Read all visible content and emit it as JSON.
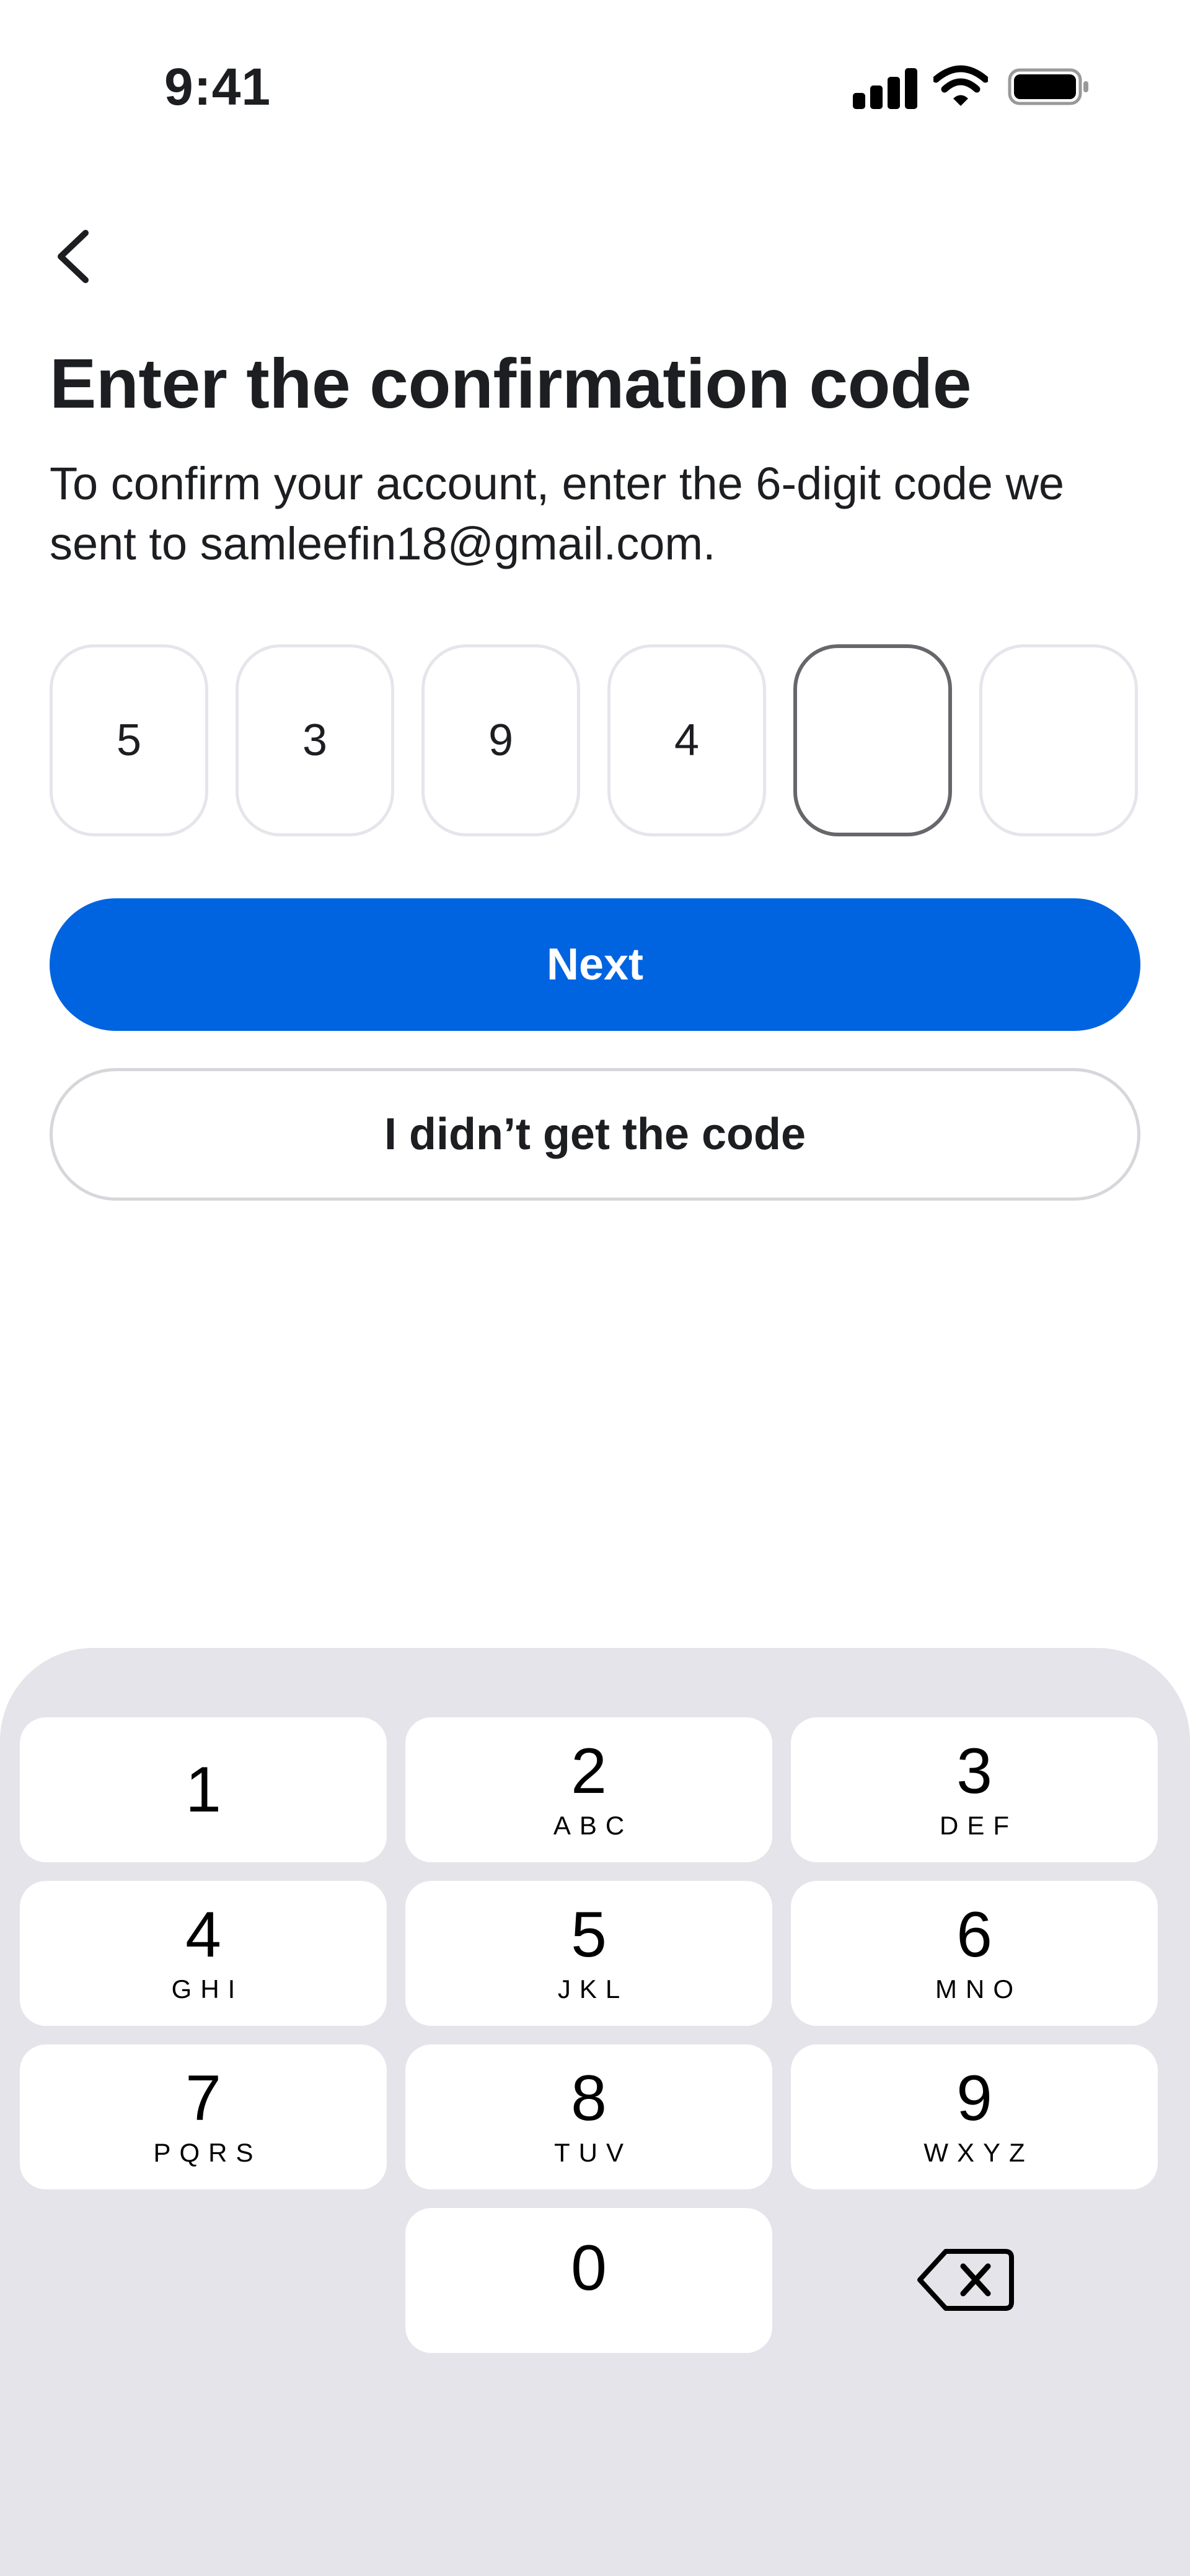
{
  "status_bar": {
    "time": "9:41"
  },
  "header": {
    "back_icon": "chevron-left-icon"
  },
  "main": {
    "title": "Enter the confirmation code",
    "subtitle": "To confirm your account, enter the 6-digit code we sent to samleefin18@gmail.com.",
    "code_digits": [
      "5",
      "3",
      "9",
      "4",
      "",
      ""
    ],
    "next_label": "Next",
    "resend_label": "I didn’t get the code"
  },
  "keyboard": {
    "keys": [
      {
        "num": "1",
        "letters": ""
      },
      {
        "num": "2",
        "letters": "ABC"
      },
      {
        "num": "3",
        "letters": "DEF"
      },
      {
        "num": "4",
        "letters": "GHI"
      },
      {
        "num": "5",
        "letters": "JKL"
      },
      {
        "num": "6",
        "letters": "MNO"
      },
      {
        "num": "7",
        "letters": "PQRS"
      },
      {
        "num": "8",
        "letters": "TUV"
      },
      {
        "num": "9",
        "letters": "WXYZ"
      },
      {
        "num": "0",
        "letters": ""
      }
    ],
    "delete_icon": "backspace-icon"
  },
  "colors": {
    "primary": "#0064e0",
    "keyboard_bg": "#e4e4ea"
  }
}
